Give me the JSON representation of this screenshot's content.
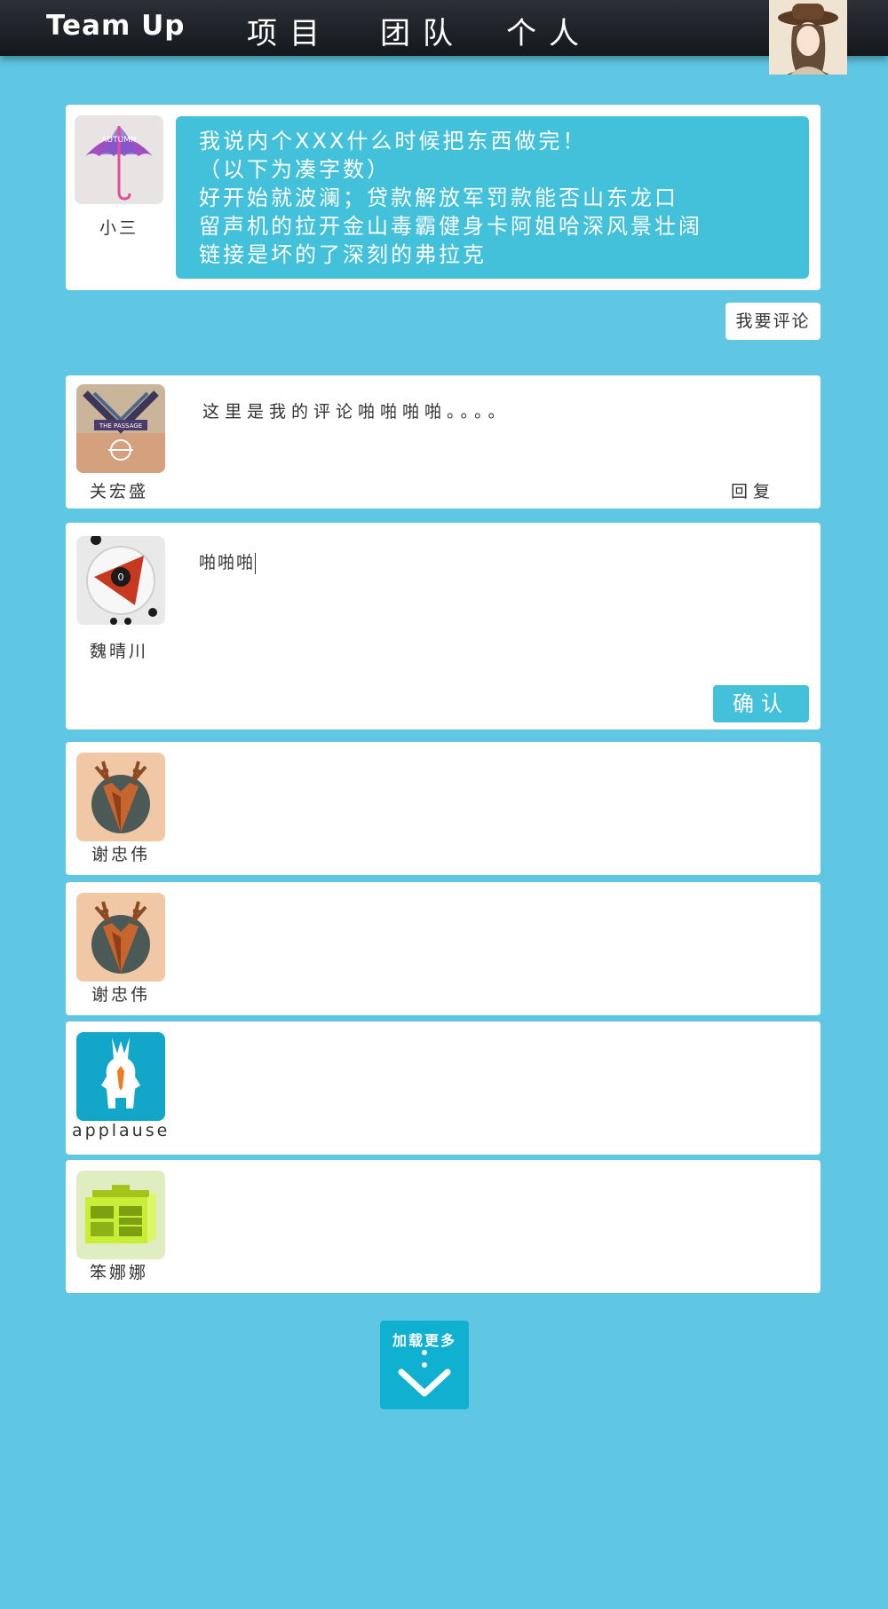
{
  "header": {
    "logo": "Team Up",
    "nav": [
      "项目",
      "团队",
      "个人"
    ]
  },
  "post": {
    "author": "小三",
    "lines": [
      "我说内个XXX什么时候把东西做完！",
      "（以下为凑字数）",
      "好开始就波澜；贷款解放军罚款能否山东龙口",
      "留声机的拉开金山毒霸健身卡阿姐哈深风景壮阔",
      "链接是坏的了深刻的弗拉克"
    ]
  },
  "comment_button": "我要评论",
  "comments": [
    {
      "author": "关宏盛",
      "text": "这里是我的评论啪啪啪啪。。。。",
      "reply_label": "回复"
    }
  ],
  "reply_box": {
    "author": "魏晴川",
    "value": "啪啪啪",
    "confirm_label": "确认"
  },
  "members": [
    {
      "name": "谢忠伟",
      "avatar": "deer-icon"
    },
    {
      "name": "谢忠伟",
      "avatar": "deer-icon"
    },
    {
      "name": "applause",
      "avatar": "bunny-icon"
    },
    {
      "name": "笨娜娜",
      "avatar": "radio-icon"
    }
  ],
  "load_more": {
    "label": "加载更多",
    "icon": "chevron-down-icon"
  },
  "colors": {
    "background": "#5fc7e4",
    "accent": "#43c1da",
    "load_more": "#10b0d1",
    "header": "#1b1e22"
  }
}
